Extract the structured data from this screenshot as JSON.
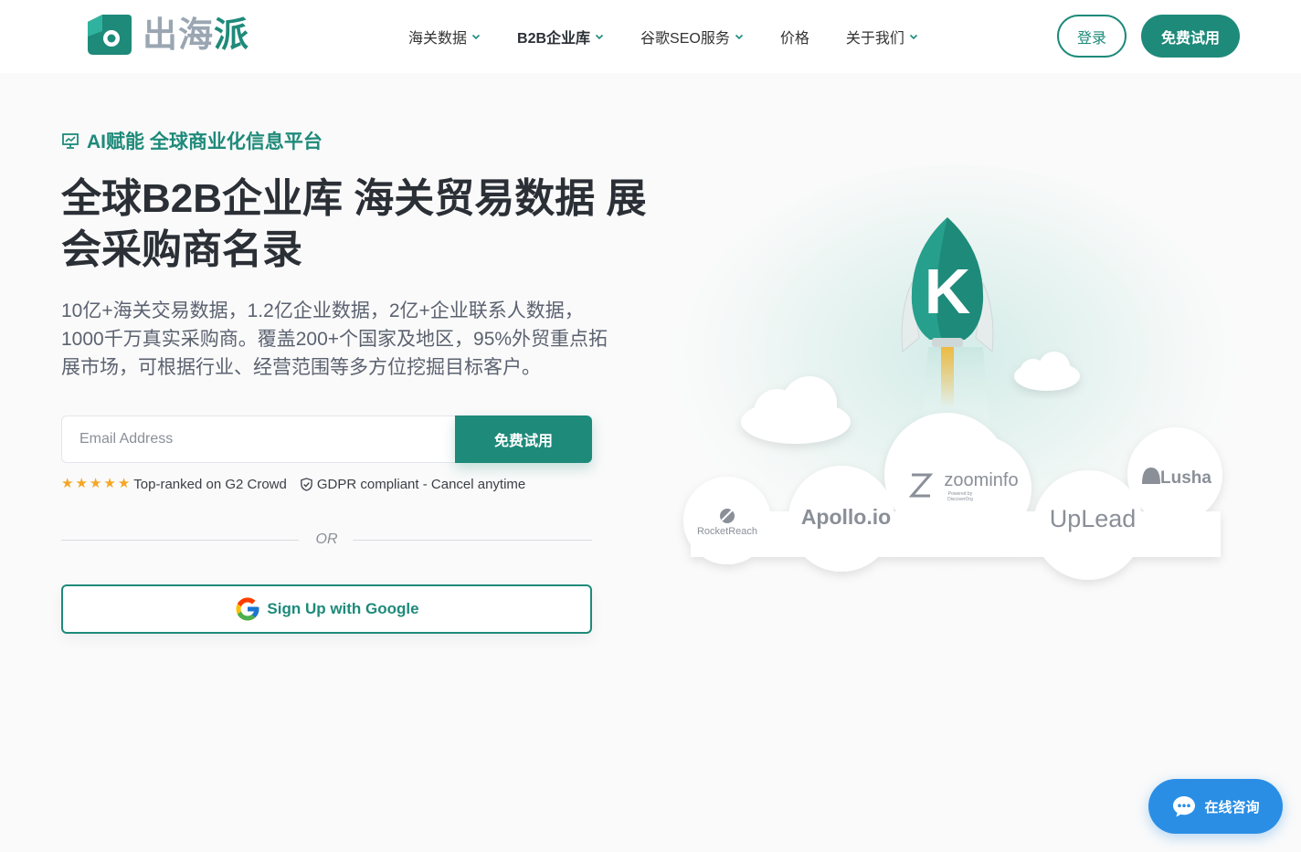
{
  "header": {
    "brand": {
      "prefix": "出海",
      "accent": "派"
    },
    "nav": [
      {
        "label": "海关数据",
        "has_dropdown": true,
        "bold": false
      },
      {
        "label": "B2B企业库",
        "has_dropdown": true,
        "bold": true
      },
      {
        "label": "谷歌SEO服务",
        "has_dropdown": true,
        "bold": false
      },
      {
        "label": "价格",
        "has_dropdown": false,
        "bold": false
      },
      {
        "label": "关于我们",
        "has_dropdown": true,
        "bold": false
      }
    ],
    "login_label": "登录",
    "trial_label": "免费试用"
  },
  "hero": {
    "tagline": "AI赋能 全球商业化信息平台",
    "title_line1": "全球B2B企业库 海关贸易数据 展",
    "title_line2": "会采购商名录",
    "description": "10亿+海关交易数据，1.2亿企业数据，2亿+企业联系人数据，1000千万真实采购商。覆盖200+个国家及地区，95%外贸重点拓展市场，可根据行业、经营范围等多方位挖掘目标客户。",
    "email_placeholder": "Email Address",
    "form_button_label": "免费试用",
    "rating_stars": 5,
    "trust_g2": "Top-ranked on G2 Crowd",
    "trust_gdpr": "GDPR compliant - Cancel anytime",
    "or_label": "OR",
    "google_button_label": "Sign Up with Google"
  },
  "illustration": {
    "rocket_letter": "K",
    "logos": [
      "RocketReach",
      "Apollo.io",
      "zoominfo",
      "Powered by DiscoverOrg",
      "UpLead",
      "Lusha"
    ]
  },
  "chat": {
    "label": "在线咨询"
  },
  "colors": {
    "brand": "#1e8a7a",
    "chat": "#2a8ee5",
    "star": "#f5a623"
  }
}
